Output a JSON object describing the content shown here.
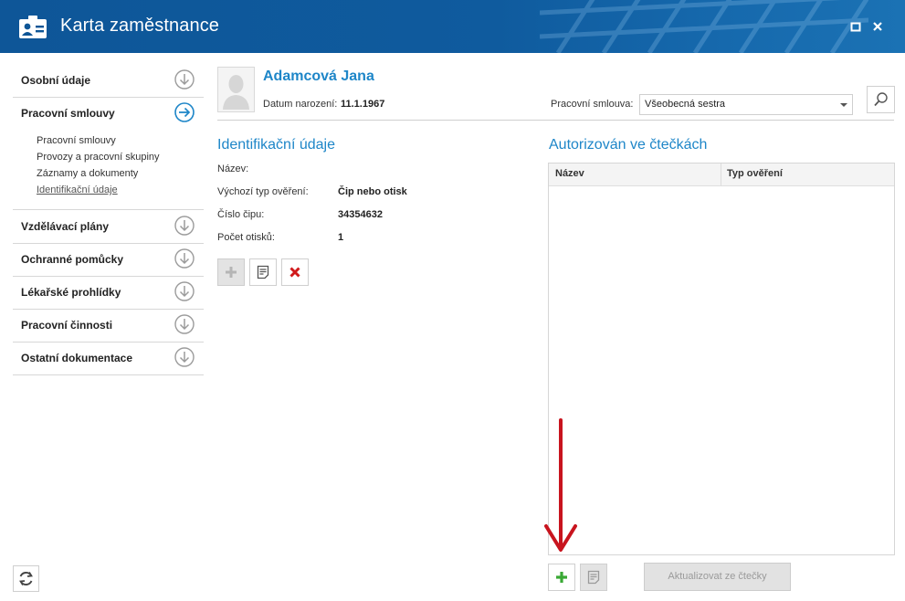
{
  "window": {
    "title": "Karta zaměstnance",
    "maximize_glyph": "□",
    "close_glyph": "✕"
  },
  "sidebar": {
    "sections": [
      {
        "label": "Osobní údaje",
        "icon": "chevron-down-circle-icon"
      },
      {
        "label": "Pracovní smlouvy",
        "icon": "arrow-right-circle-icon",
        "expanded": true
      },
      {
        "label": "Vzdělávací plány",
        "icon": "chevron-down-circle-icon"
      },
      {
        "label": "Ochranné pomůcky",
        "icon": "chevron-down-circle-icon"
      },
      {
        "label": "Lékařské prohlídky",
        "icon": "chevron-down-circle-icon"
      },
      {
        "label": "Pracovní činnosti",
        "icon": "chevron-down-circle-icon"
      },
      {
        "label": "Ostatní dokumentace",
        "icon": "chevron-down-circle-icon"
      }
    ],
    "subitems": [
      {
        "label": "Pracovní smlouvy"
      },
      {
        "label": "Provozy a pracovní skupiny"
      },
      {
        "label": "Záznamy a dokumenty"
      },
      {
        "label": "Identifikační údaje",
        "active": true
      }
    ]
  },
  "employee": {
    "name": "Adamcová Jana",
    "birth_label": "Datum narození:",
    "birth_value": "11.1.1967",
    "contract_label": "Pracovní smlouva:",
    "contract_value": "Všeobecná sestra"
  },
  "identification": {
    "title": "Identifikační údaje",
    "fields": [
      {
        "label": "Název:",
        "value": ""
      },
      {
        "label": "Výchozí typ ověření:",
        "value": "Čip nebo otisk"
      },
      {
        "label": "Číslo čipu:",
        "value": "34354632"
      },
      {
        "label": "Počet otisků:",
        "value": "1"
      }
    ]
  },
  "readers": {
    "title": "Autorizován ve čtečkách",
    "columns": [
      "Název",
      "Typ ověření"
    ],
    "rows": [],
    "update_button": "Aktualizovat ze čtečky"
  },
  "colors": {
    "titlebar": "#0d5596",
    "accent": "#1e86c8",
    "add_green": "#3aa935",
    "delete_red": "#d0191b",
    "annotation_arrow": "#c8141e"
  }
}
